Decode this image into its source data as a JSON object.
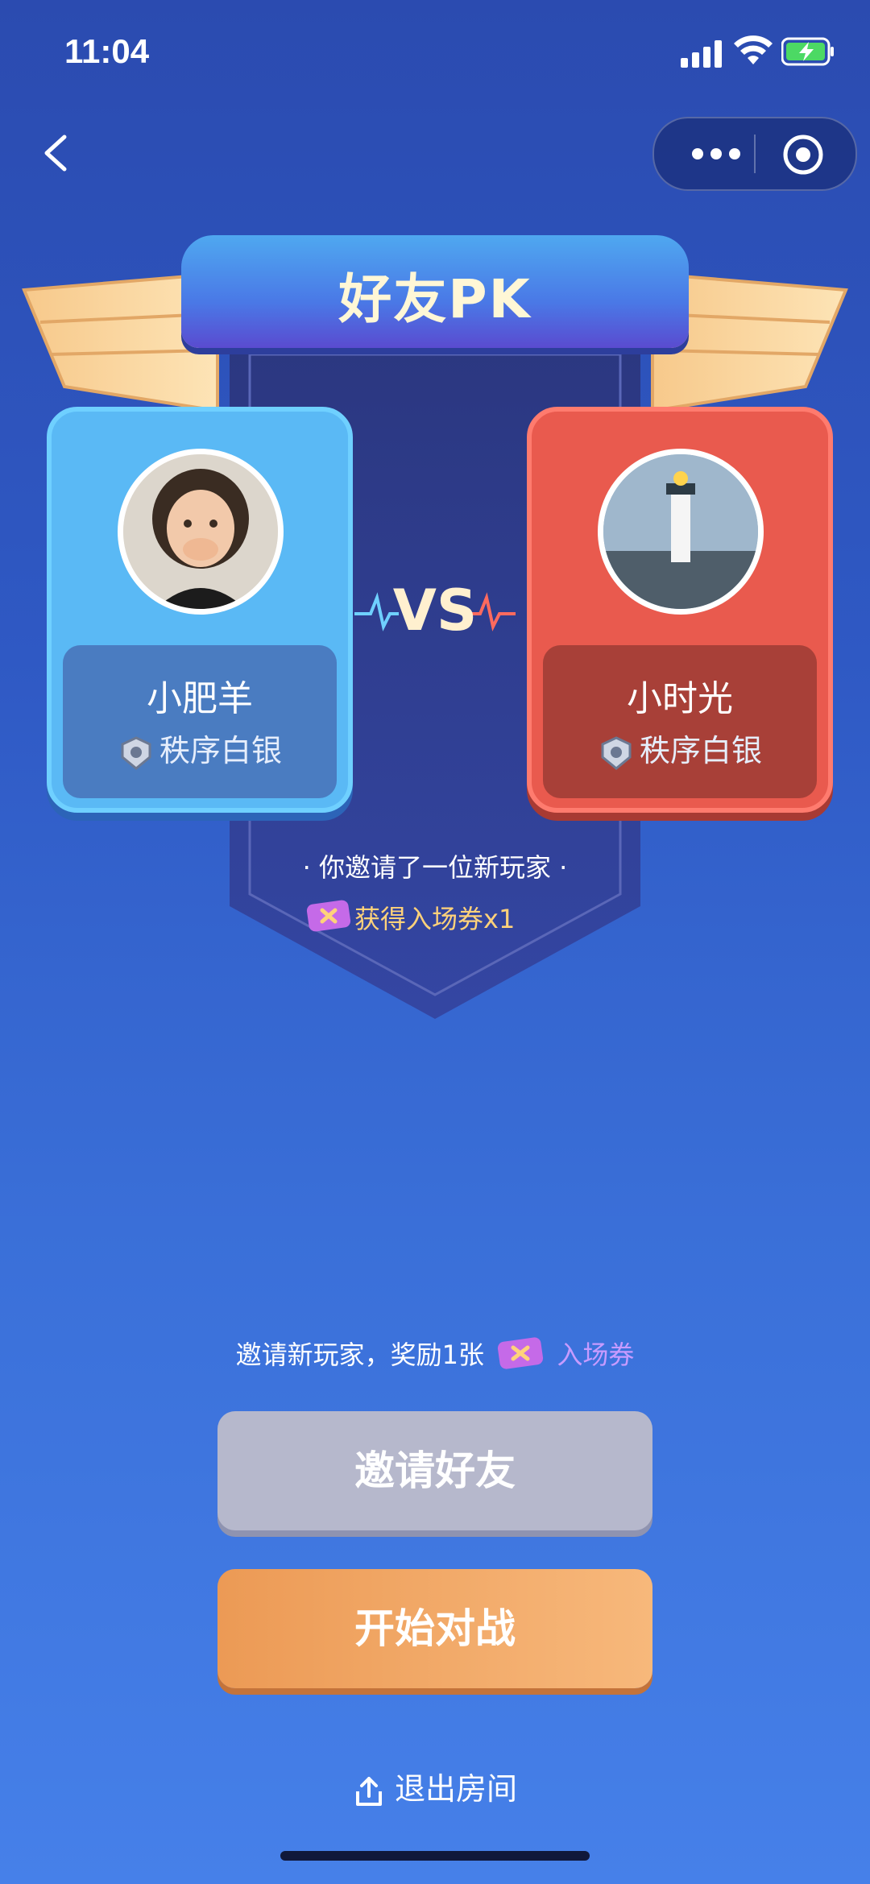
{
  "status_bar": {
    "time": "11:04"
  },
  "header": {
    "title": "好友PK"
  },
  "players": {
    "left": {
      "name": "小肥羊",
      "rank": "秩序白银"
    },
    "right": {
      "name": "小时光",
      "rank": "秩序白银"
    }
  },
  "versus": {
    "label": "VS"
  },
  "invite_result": {
    "message": "· 你邀请了一位新玩家 ·",
    "ticket_reward": "获得入场券x1"
  },
  "reward_hint": {
    "prefix": "邀请新玩家，奖励1张",
    "ticket_label": "入场券"
  },
  "buttons": {
    "invite": "邀请好友",
    "start": "开始对战"
  },
  "footer": {
    "exit": "退出房间"
  },
  "colors": {
    "accent_blue": "#5ab9f5",
    "accent_red": "#e95a4e",
    "start_orange": "#ef9d5a",
    "invite_gray": "#b6b8cc"
  }
}
